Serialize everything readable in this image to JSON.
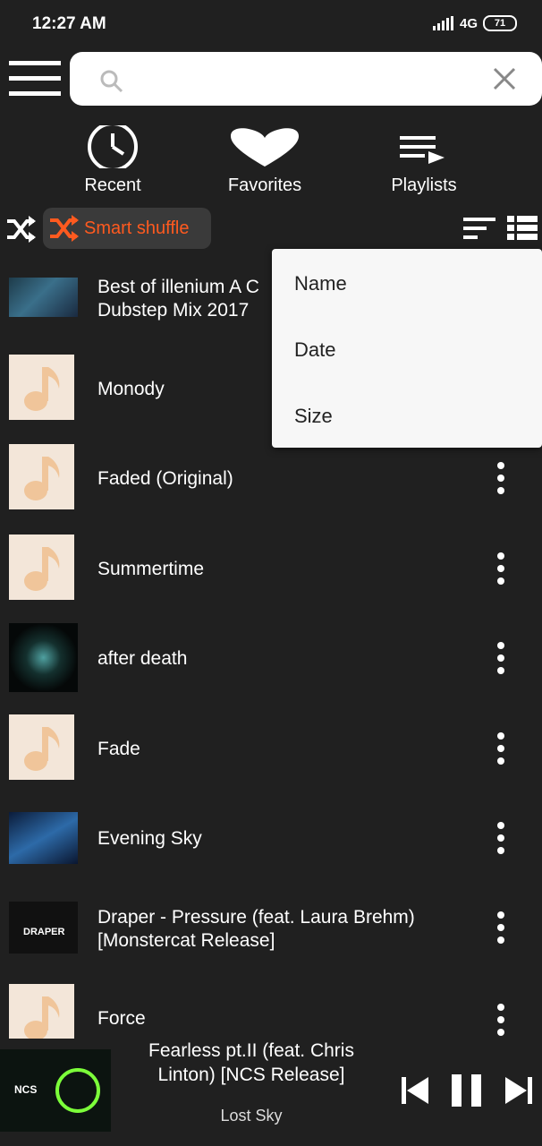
{
  "status": {
    "time": "12:27 AM",
    "network": "4G",
    "battery": "71"
  },
  "search": {
    "placeholder": ""
  },
  "tabs": [
    {
      "label": "Recent"
    },
    {
      "label": "Favorites"
    },
    {
      "label": "Playlists"
    }
  ],
  "toolbar": {
    "smart_shuffle_label": "Smart shuffle"
  },
  "sort_menu": {
    "items": [
      "Name",
      "Date",
      "Size"
    ]
  },
  "songs": [
    {
      "title_line1": "Best of illenium   A C",
      "title_line2": "Dubstep Mix 2017"
    },
    {
      "title": "Monody"
    },
    {
      "title": "Faded (Original)"
    },
    {
      "title": "Summertime"
    },
    {
      "title": "after death"
    },
    {
      "title": "Fade"
    },
    {
      "title": "Evening Sky"
    },
    {
      "title_line1": "Draper - Pressure (feat. Laura Brehm)",
      "title_line2": "[Monstercat Release]"
    },
    {
      "title": "Force"
    }
  ],
  "thumb_text": {
    "draper": "DRAPER",
    "ncs": "NCS"
  },
  "now_playing": {
    "title_line1": "Fearless pt.II (feat. Chris",
    "title_line2": "Linton) [NCS Release]",
    "artist": "Lost Sky"
  },
  "colors": {
    "accent": "#ff5a1f",
    "background": "#202020",
    "thumb_bg": "#f3e6d9",
    "note": "#f0c59a"
  }
}
